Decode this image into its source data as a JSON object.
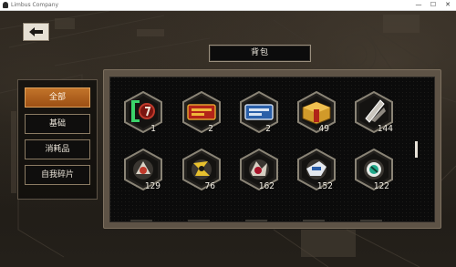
{
  "window": {
    "title": "Limbus Company",
    "minimize_glyph": "—",
    "maximize_glyph": "☐",
    "close_glyph": "✕"
  },
  "header": {
    "title": "背包"
  },
  "back_button": {
    "icon": "back-arrow-icon"
  },
  "categories": [
    {
      "label": "全部",
      "active": true
    },
    {
      "label": "基础",
      "active": false
    },
    {
      "label": "消耗品",
      "active": false
    },
    {
      "label": "自我碎片",
      "active": false
    }
  ],
  "inventory": {
    "items": [
      {
        "icon": "green-bracket-icon",
        "count": "1"
      },
      {
        "icon": "red-ticket-icon",
        "count": "2"
      },
      {
        "icon": "blue-ticket-icon",
        "count": "2"
      },
      {
        "icon": "gold-crate-icon",
        "count": "49"
      },
      {
        "icon": "silver-shard-icon",
        "count": "144"
      },
      {
        "icon": "ego-shard-red-icon",
        "count": "129"
      },
      {
        "icon": "ego-shard-yellow-icon",
        "count": "76"
      },
      {
        "icon": "ego-shard-crimson-icon",
        "count": "162"
      },
      {
        "icon": "ego-shard-blue-icon",
        "count": "152"
      },
      {
        "icon": "ego-shard-teal-icon",
        "count": "122"
      }
    ]
  },
  "colors": {
    "accent_orange": "#b8651f",
    "panel_frame": "#5e5346",
    "hex_frame": "#8a8476"
  }
}
